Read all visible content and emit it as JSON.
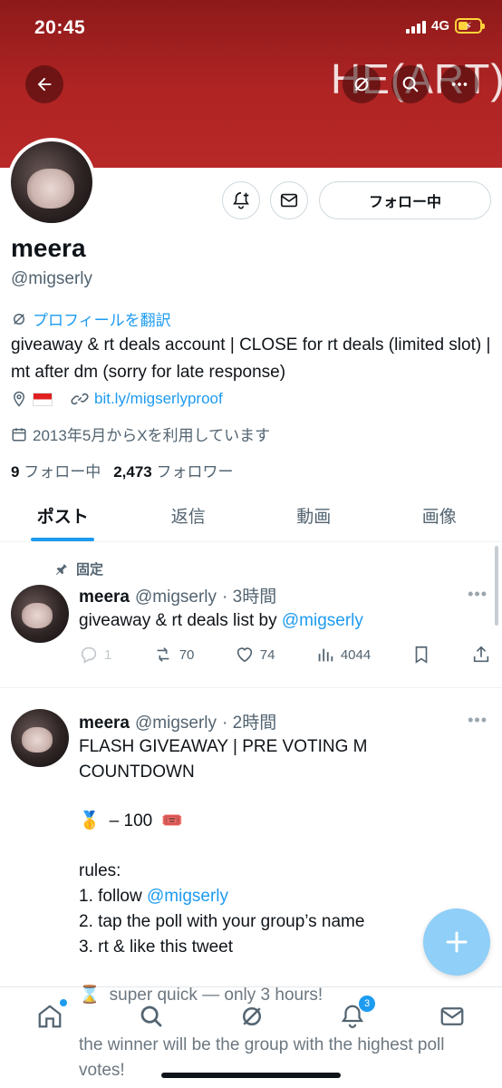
{
  "status_bar": {
    "time": "20:45",
    "network": "4G"
  },
  "header": {
    "banner_text": "HE(ART)"
  },
  "profile": {
    "name": "meera",
    "handle": "@migserly",
    "translate_label": "プロフィールを翻訳",
    "bio": "giveaway & rt deals account | CLOSE for rt deals (limited slot) | mt after dm (sorry for late response)",
    "link": "bit.ly/migserlyproof",
    "joined": "2013年5月からXを利用しています",
    "following_count": "9",
    "following_label": "フォロー中",
    "followers_count": "2,473",
    "followers_label": "フォロワー",
    "follow_button_label": "フォロー中"
  },
  "tabs": [
    {
      "label": "ポスト",
      "active": true
    },
    {
      "label": "返信",
      "active": false
    },
    {
      "label": "動画",
      "active": false
    },
    {
      "label": "画像",
      "active": false
    }
  ],
  "posts": [
    {
      "pinned_label": "固定",
      "name": "meera",
      "handle": "@migserly",
      "time": "· 3時間",
      "text_before": "giveaway & rt deals list by ",
      "mention": "@migserly",
      "replies": "1",
      "reposts": "70",
      "likes": "74",
      "views": "4044"
    },
    {
      "name": "meera",
      "handle": "@migserly",
      "time": "· 2時間",
      "line1": "FLASH GIVEAWAY | PRE VOTING M",
      "line2": "COUNTDOWN",
      "prize_emoji": "🥇",
      "prize_text": "– 100",
      "ticket_emoji": "🎟️",
      "rules_label": "rules:",
      "rule1_prefix": "1. follow ",
      "rule1_mention": "@migserly",
      "rule2": "2. tap the poll with your group’s name",
      "rule3": "3. rt & like this tweet",
      "hourglass_emoji": "⌛",
      "quick": "super quick — only 3 hours!",
      "winner": "the winner will be the group with the highest poll votes!"
    }
  ],
  "bottom_nav": {
    "notification_count": "3"
  },
  "colors": {
    "accent": "#1d9bf0",
    "banner": "#b02424"
  }
}
